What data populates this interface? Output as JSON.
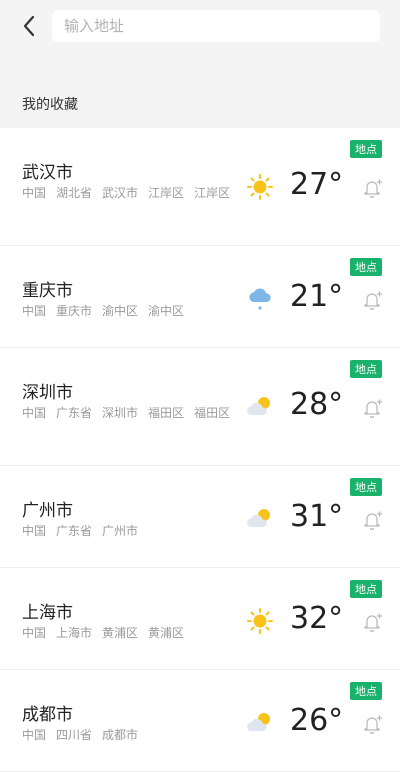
{
  "search": {
    "placeholder": "输入地址",
    "value": ""
  },
  "section_title": "我的收藏",
  "tag_label": "地点",
  "cities": [
    {
      "name": "武汉市",
      "region": [
        "中国",
        "湖北省",
        "武汉市",
        "江岸区",
        "江岸区"
      ],
      "temp": "27°",
      "weather": "sunny",
      "tall": true
    },
    {
      "name": "重庆市",
      "region": [
        "中国",
        "重庆市",
        "渝中区",
        "渝中区"
      ],
      "temp": "21°",
      "weather": "rain",
      "tall": false
    },
    {
      "name": "深圳市",
      "region": [
        "中国",
        "广东省",
        "深圳市",
        "福田区",
        "福田区"
      ],
      "temp": "28°",
      "weather": "partly-cloudy",
      "tall": true
    },
    {
      "name": "广州市",
      "region": [
        "中国",
        "广东省",
        "广州市"
      ],
      "temp": "31°",
      "weather": "partly-cloudy",
      "tall": false
    },
    {
      "name": "上海市",
      "region": [
        "中国",
        "上海市",
        "黄浦区",
        "黄浦区"
      ],
      "temp": "32°",
      "weather": "sunny",
      "tall": false
    },
    {
      "name": "成都市",
      "region": [
        "中国",
        "四川省",
        "成都市"
      ],
      "temp": "26°",
      "weather": "partly-cloudy",
      "tall": false
    }
  ],
  "colors": {
    "accent": "#18b26a",
    "sun": "#f7c21a",
    "rain": "#7fb6e8"
  }
}
